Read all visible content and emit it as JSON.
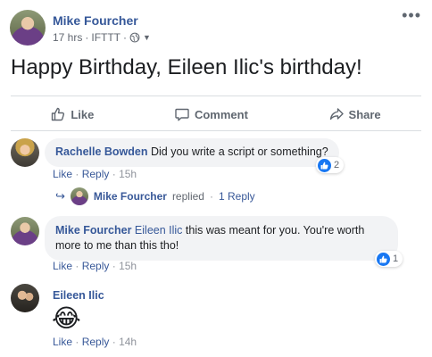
{
  "post": {
    "author": "Mike Fourcher",
    "time": "17 hrs",
    "via": "IFTTT",
    "dot": "·",
    "text": "Happy Birthday, Eileen Ilic's birthday!"
  },
  "actions": {
    "like": "Like",
    "comment": "Comment",
    "share": "Share"
  },
  "comments": [
    {
      "author": "Rachelle Bowden",
      "text": "Did you write a script or something?",
      "like": "Like",
      "reply": "Reply",
      "time": "15h",
      "reactions": "2"
    },
    {
      "author": "Mike Fourcher",
      "tag": "Eileen Ilic",
      "text": "this was meant for you. You're worth more to me than this tho!",
      "like": "Like",
      "reply": "Reply",
      "time": "15h",
      "reactions": "1"
    },
    {
      "author": "Eileen Ilic",
      "emoji": "😂",
      "like": "Like",
      "reply": "Reply",
      "time": "14h"
    }
  ],
  "reply_summary": {
    "name": "Mike Fourcher",
    "action": "replied",
    "count": "1 Reply"
  },
  "colors": {
    "link": "#365899",
    "meta": "#616770",
    "bubble": "#f2f3f5",
    "like_blue": "#1877f2"
  },
  "icons": [
    "more-icon",
    "globe-icon",
    "caret-down-icon",
    "like-icon",
    "comment-icon",
    "share-icon",
    "reply-arrow-icon"
  ]
}
